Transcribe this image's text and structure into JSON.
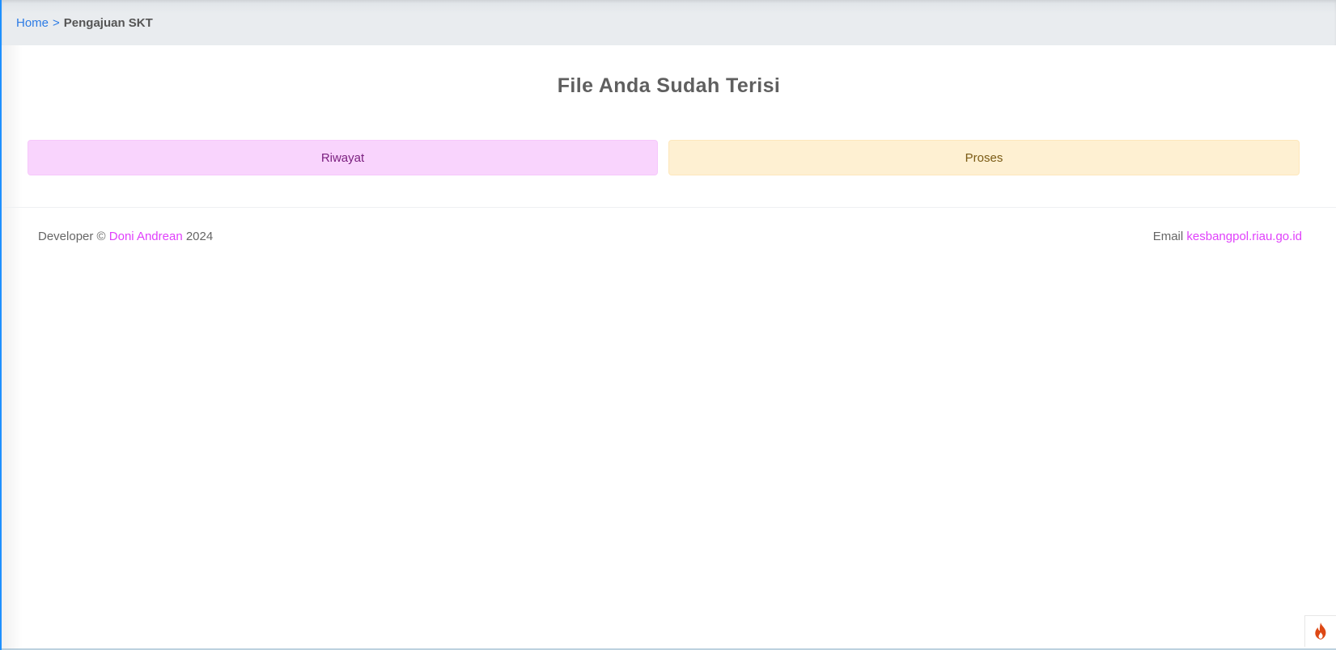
{
  "breadcrumb": {
    "home": "Home",
    "separator": ">",
    "current": "Pengajuan SKT"
  },
  "main": {
    "title": "File Anda Sudah Terisi",
    "status_buttons": [
      {
        "label": "Riwayat",
        "color": "#f9d4fd"
      },
      {
        "label": "Proses",
        "color": "#fef0d2"
      }
    ]
  },
  "footer": {
    "developer_prefix": "Developer ©",
    "developer_name": "Doni Andrean",
    "year": "2024",
    "email_label": "Email",
    "email_link": "kesbangpol.riau.go.id"
  },
  "icons": {
    "corner": "flame-icon"
  },
  "colors": {
    "accent_link": "#2c7be5",
    "pink_link": "#e040fb",
    "left_border": "#1e90ff"
  }
}
